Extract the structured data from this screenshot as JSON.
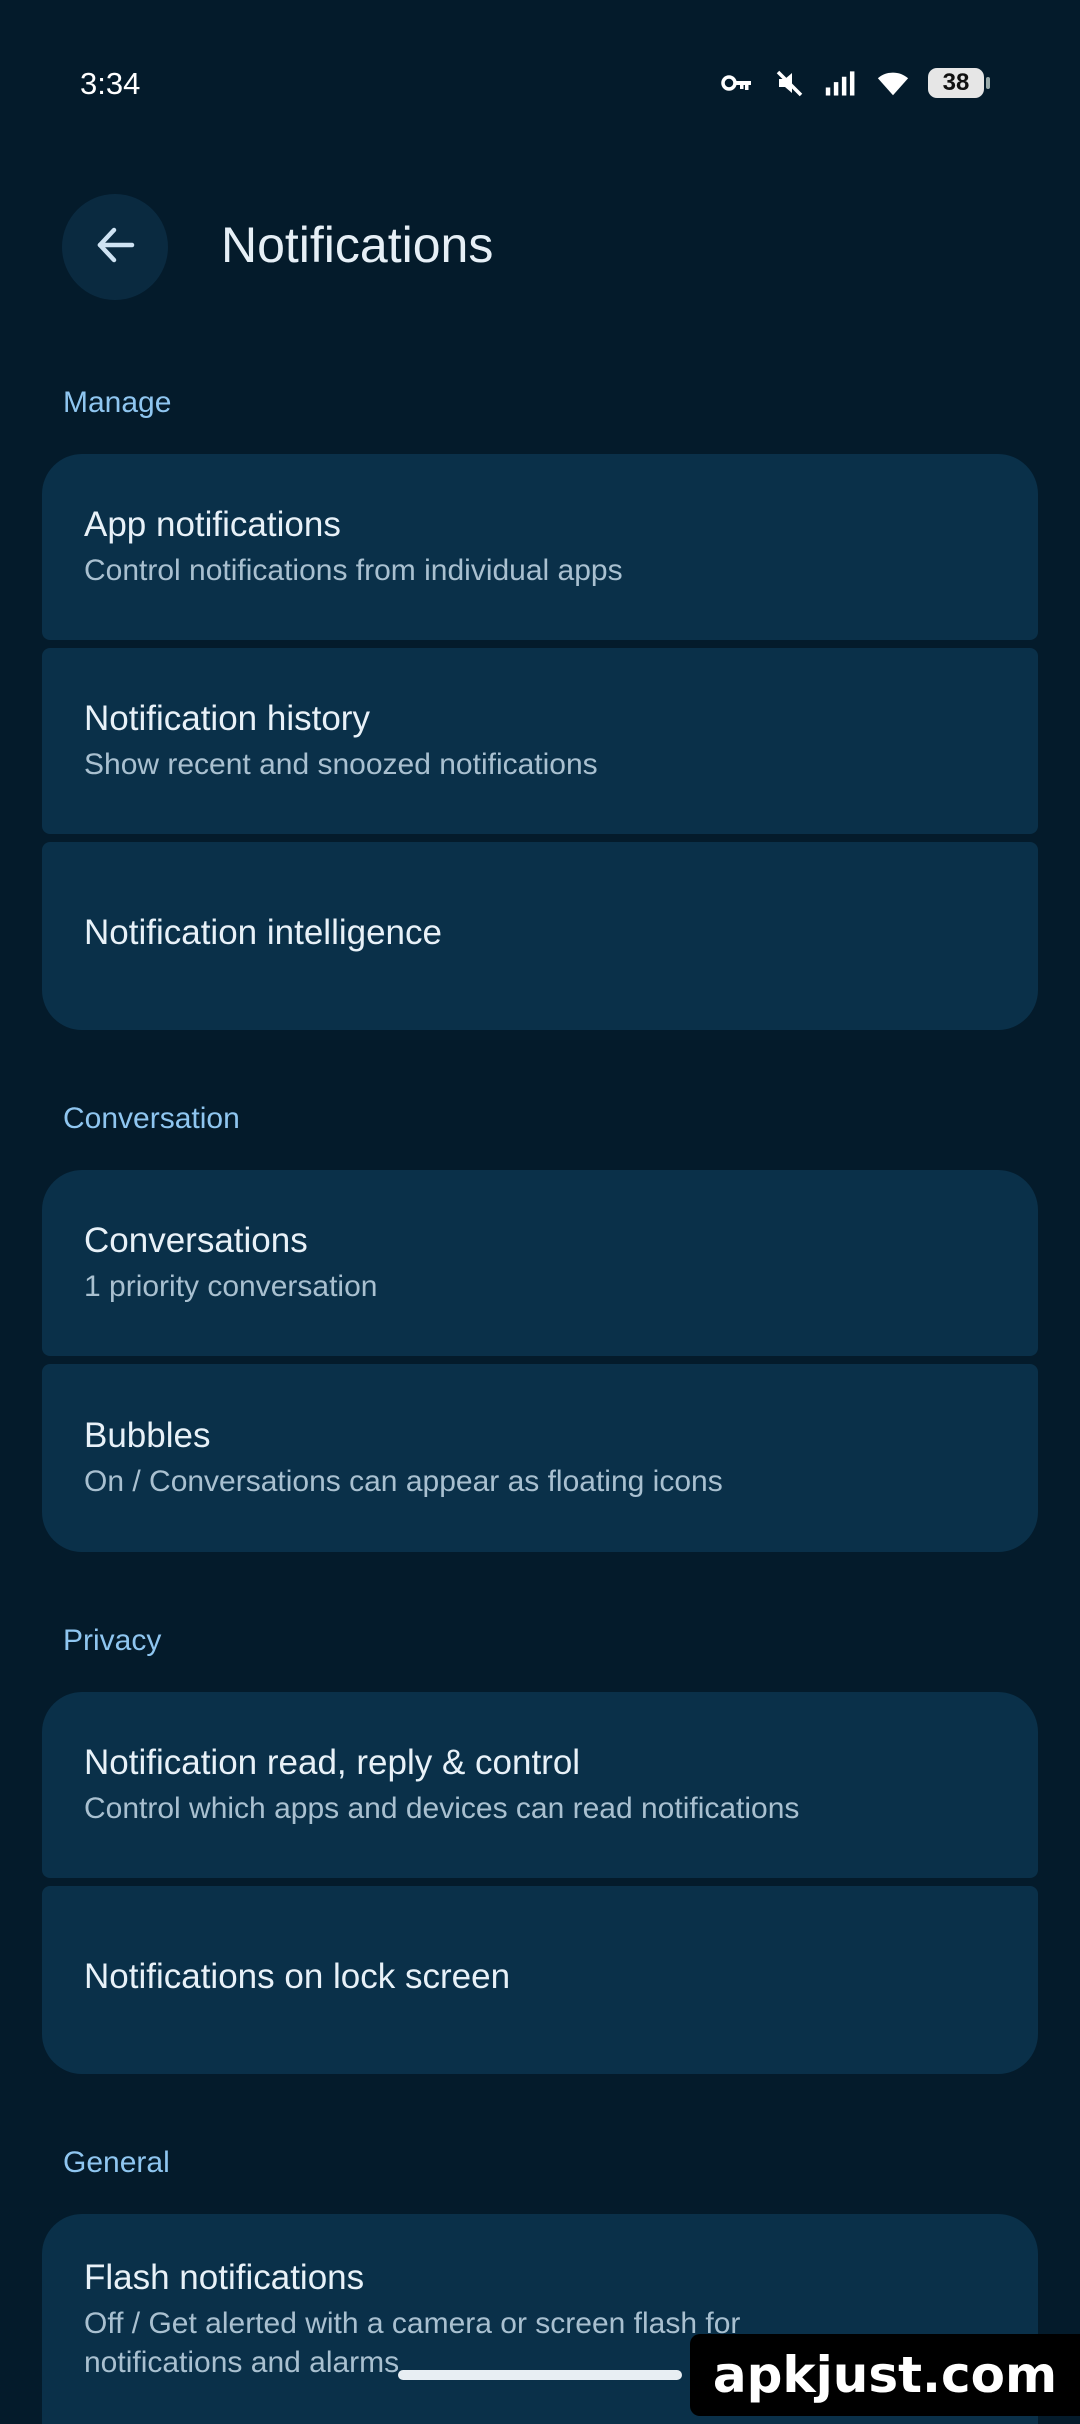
{
  "status": {
    "time": "3:34",
    "battery": "38"
  },
  "header": {
    "title": "Notifications"
  },
  "sections": {
    "manage": {
      "label": "Manage",
      "items": [
        {
          "title": "App notifications",
          "subtitle": "Control notifications from individual apps"
        },
        {
          "title": "Notification history",
          "subtitle": "Show recent and snoozed notifications"
        },
        {
          "title": "Notification intelligence"
        }
      ]
    },
    "conversation": {
      "label": "Conversation",
      "items": [
        {
          "title": "Conversations",
          "subtitle": "1 priority conversation"
        },
        {
          "title": "Bubbles",
          "subtitle": "On / Conversations can appear as floating icons"
        }
      ]
    },
    "privacy": {
      "label": "Privacy",
      "items": [
        {
          "title": "Notification read, reply & control",
          "subtitle": "Control which apps and devices can read notifications"
        },
        {
          "title": "Notifications on lock screen"
        }
      ]
    },
    "general": {
      "label": "General",
      "items": [
        {
          "title": "Flash notifications",
          "subtitle": "Off / Get alerted with a camera or screen flash for notifications and alarms"
        }
      ]
    }
  },
  "watermark": "apkjust.com",
  "icons": [
    "vpn-key-icon",
    "mute-icon",
    "signal-icon",
    "wifi-icon",
    "battery-icon",
    "back-arrow-icon"
  ]
}
